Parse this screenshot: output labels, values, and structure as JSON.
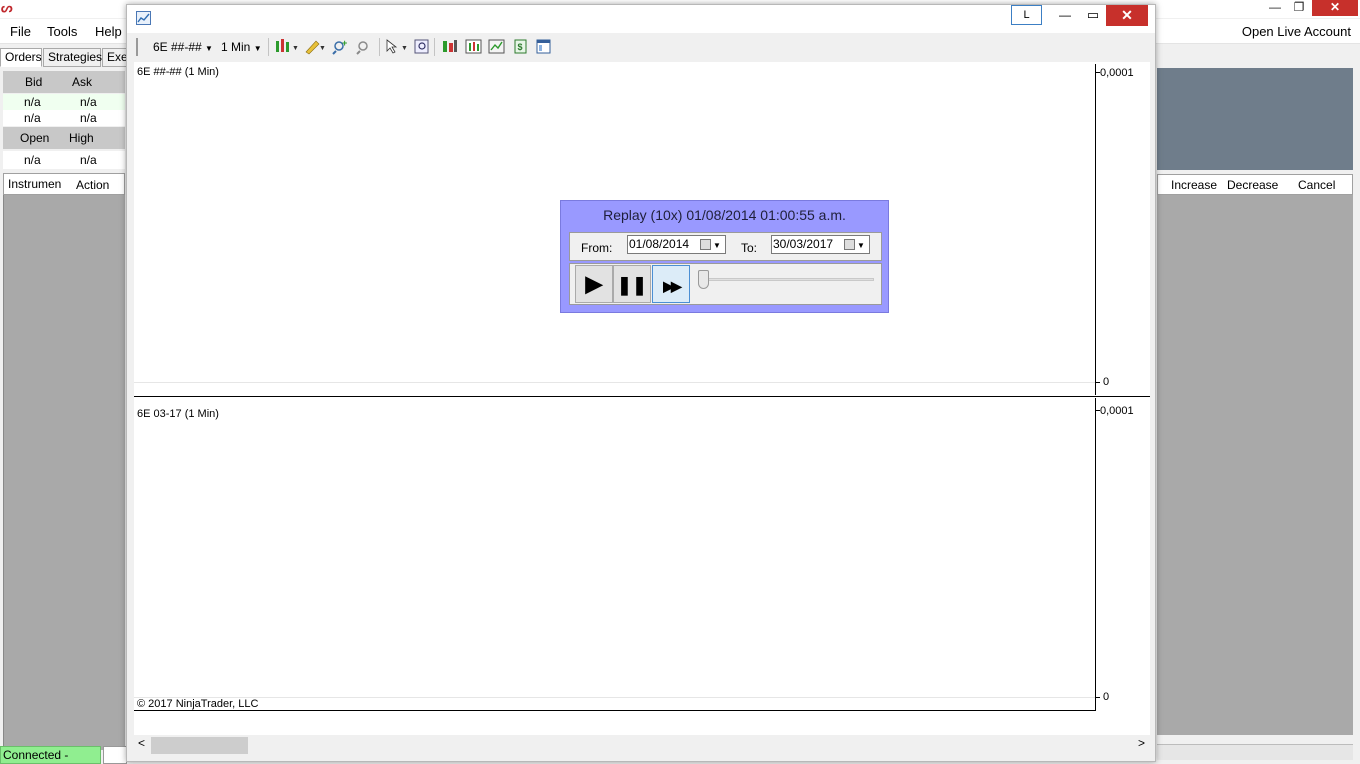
{
  "main": {
    "menu": [
      "File",
      "Tools",
      "Help"
    ],
    "open_live_account": "Open Live Account",
    "window_buttons": {
      "minimize": "—",
      "restore": "❐",
      "close": "✕"
    }
  },
  "left_panel": {
    "tabs": [
      "Orders",
      "Strategies",
      "Exe"
    ],
    "quote": {
      "headers1": [
        "Bid",
        "Ask"
      ],
      "row1": [
        "n/a",
        "n/a"
      ],
      "row2": [
        "n/a",
        "n/a"
      ],
      "headers2": [
        "Open",
        "High"
      ],
      "row3": [
        "n/a",
        "n/a"
      ]
    },
    "columns": [
      "Instrumen",
      "Action"
    ]
  },
  "right_panel": {
    "columns": [
      "Increase",
      "Decrease",
      "Cancel"
    ]
  },
  "status_bar": {
    "connection": "Connected - Replay"
  },
  "chart_window": {
    "title_button": "L",
    "window_buttons": {
      "minimize": "—",
      "maximize": "▭",
      "close": "✕"
    },
    "toolbar": {
      "instrument": "6E ##-##",
      "interval": "1 Min"
    },
    "panels": [
      {
        "title": "6E ##-## (1 Min)",
        "y_top": "0,0001",
        "y_bottom": "0"
      },
      {
        "title": "6E 03-17 (1 Min)",
        "y_top": "0,0001",
        "y_bottom": "0"
      }
    ],
    "copyright": "© 2017 NinjaTrader, LLC",
    "scroll": {
      "left": "<",
      "right": ">"
    }
  },
  "replay": {
    "title": "Replay (10x) 01/08/2014 01:00:55 a.m.",
    "from_label": "From:",
    "from_date": "01/08/2014",
    "to_label": "To:",
    "to_date": "30/03/2017",
    "speed": "10x",
    "buttons": {
      "play": "▶",
      "pause": "❚❚",
      "fast_forward": "▶▶"
    }
  }
}
